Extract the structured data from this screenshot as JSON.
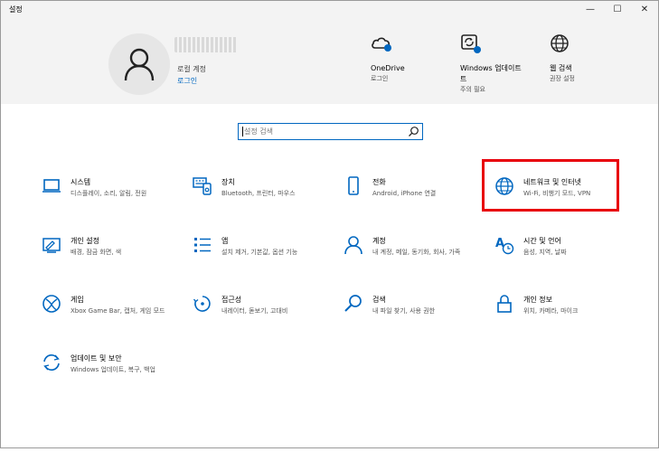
{
  "window": {
    "title": "설정",
    "minimize": "—",
    "maximize": "☐",
    "close": "✕"
  },
  "account": {
    "subtitle": "로컬 계정",
    "login_link": "로그인"
  },
  "quick": [
    {
      "title": "OneDrive",
      "sub": "로그인",
      "icon": "onedrive-cloud-icon"
    },
    {
      "title": "Windows 업데이트",
      "title2": "트",
      "sub": "주의 필요",
      "icon": "windows-update-icon"
    },
    {
      "title": "웹 검색",
      "sub": "권장 설정",
      "icon": "globe-icon"
    }
  ],
  "search": {
    "placeholder": "설정 검색"
  },
  "tiles": [
    {
      "name": "시스템",
      "desc": "디스플레이, 소리, 알림, 전원",
      "icon": "laptop-icon"
    },
    {
      "name": "장치",
      "desc": "Bluetooth, 프린터, 마우스",
      "icon": "keyboard-device-icon"
    },
    {
      "name": "전화",
      "desc": "Android, iPhone 연결",
      "icon": "phone-icon"
    },
    {
      "name": "네트워크 및 인터넷",
      "desc": "Wi-Fi, 비행기 모드, VPN",
      "icon": "globe-icon"
    },
    {
      "name": "개인 설정",
      "desc": "배경, 잠금 화면, 색",
      "icon": "personalization-icon"
    },
    {
      "name": "앱",
      "desc": "설치 제거, 기본값, 옵션 기능",
      "icon": "apps-list-icon"
    },
    {
      "name": "계정",
      "desc": "내 계정, 메일, 동기화, 회사, 가족",
      "icon": "person-icon"
    },
    {
      "name": "시간 및 언어",
      "desc": "음성, 지역, 날짜",
      "icon": "time-language-icon"
    },
    {
      "name": "게임",
      "desc": "Xbox Game Bar, 캡처, 게임 모드",
      "icon": "xbox-icon"
    },
    {
      "name": "접근성",
      "desc": "내레이터, 돋보기, 고대비",
      "icon": "accessibility-icon"
    },
    {
      "name": "검색",
      "desc": "내 파일 찾기, 사용 권한",
      "icon": "search-icon"
    },
    {
      "name": "개인 정보",
      "desc": "위치, 카메라, 마이크",
      "icon": "lock-icon"
    },
    {
      "name": "업데이트 및 보안",
      "desc": "Windows 업데이트, 복구, 백업",
      "icon": "update-sync-icon"
    }
  ],
  "colors": {
    "accent": "#0067c0",
    "highlight": "#e8000b",
    "header_band": "#f3f3f3"
  }
}
